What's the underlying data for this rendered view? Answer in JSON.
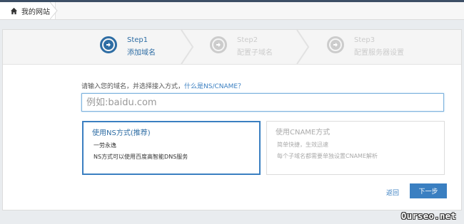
{
  "breadcrumb": {
    "home_label": "我的网站"
  },
  "steps": [
    {
      "number": "Step1",
      "label": "添加域名"
    },
    {
      "number": "Step2",
      "label": "配置子域名"
    },
    {
      "number": "Step3",
      "label": "配置服务器设置"
    }
  ],
  "domain_prompt": {
    "text": "请输入您的域名，并选择接入方式，",
    "link": "什么是NS/CNAME？"
  },
  "domain_input": {
    "placeholder": "例如:baidu.com",
    "value": ""
  },
  "options": [
    {
      "title": "使用NS方式(推荐)",
      "line1": "一劳永逸",
      "line2": "NS方式可以使用百度高智能DNS服务",
      "selected": true
    },
    {
      "title": "使用CNAME方式",
      "line1": "简单快捷，生效迅速",
      "line2": "每个子域名都需要单独设置CNAME解析",
      "selected": false
    }
  ],
  "actions": {
    "back": "返回",
    "next": "下一步"
  },
  "watermark": "Ourseo.net",
  "colors": {
    "accent": "#3a7fc1",
    "inactive": "#cccccc",
    "topbar": "#3d4f66"
  }
}
